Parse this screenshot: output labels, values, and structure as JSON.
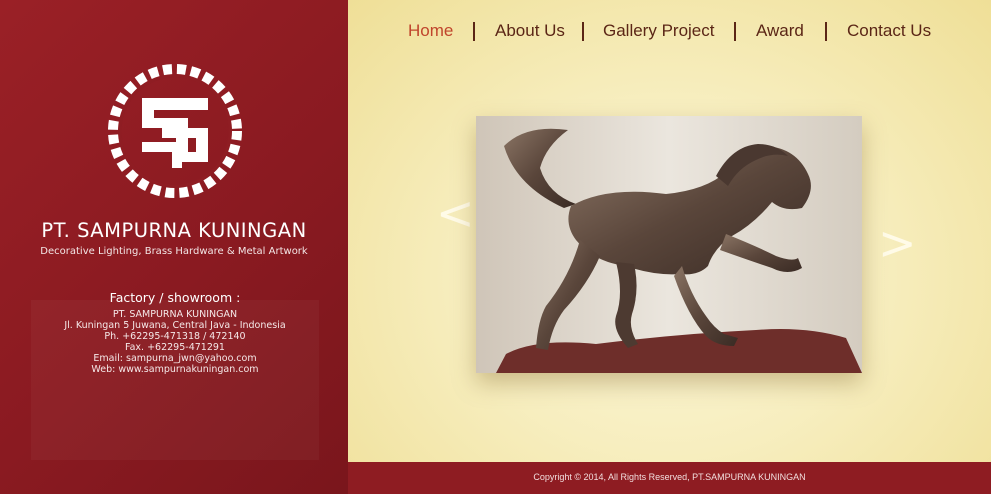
{
  "nav": {
    "items": [
      {
        "label": "Home",
        "active": true
      },
      {
        "label": "About Us",
        "active": false
      },
      {
        "label": "Gallery Project",
        "active": false
      },
      {
        "label": "Award",
        "active": false
      },
      {
        "label": "Contact Us",
        "active": false
      }
    ]
  },
  "brand": {
    "logo_icon": "sp-monogram-chain-logo",
    "name": "PT. SAMPURNA KUNINGAN",
    "tagline": "Decorative Lighting, Brass Hardware & Metal Artwork"
  },
  "factory": {
    "heading": "Factory / showroom :",
    "lines": [
      "PT. SAMPURNA KUNINGAN",
      "Jl. Kuningan 5 Juwana, Central Java - Indonesia",
      "Ph. +62295-471318 / 472140",
      "Fax. +62295-471291",
      "Email: sampurna_jwn@yahoo.com",
      "Web: www.sampurnakuningan.com"
    ]
  },
  "slider": {
    "prev_symbol": "<",
    "next_symbol": ">",
    "image": "bronze-horse-sculpture"
  },
  "footer": {
    "copyright": "Copyright © 2014, All Rights Reserved, PT.SAMPURNA KUNINGAN"
  },
  "colors": {
    "sidebar": "#8e1c22",
    "nav_text": "#5b2616",
    "nav_active": "#c0452c",
    "background": "#f3e6a8"
  }
}
